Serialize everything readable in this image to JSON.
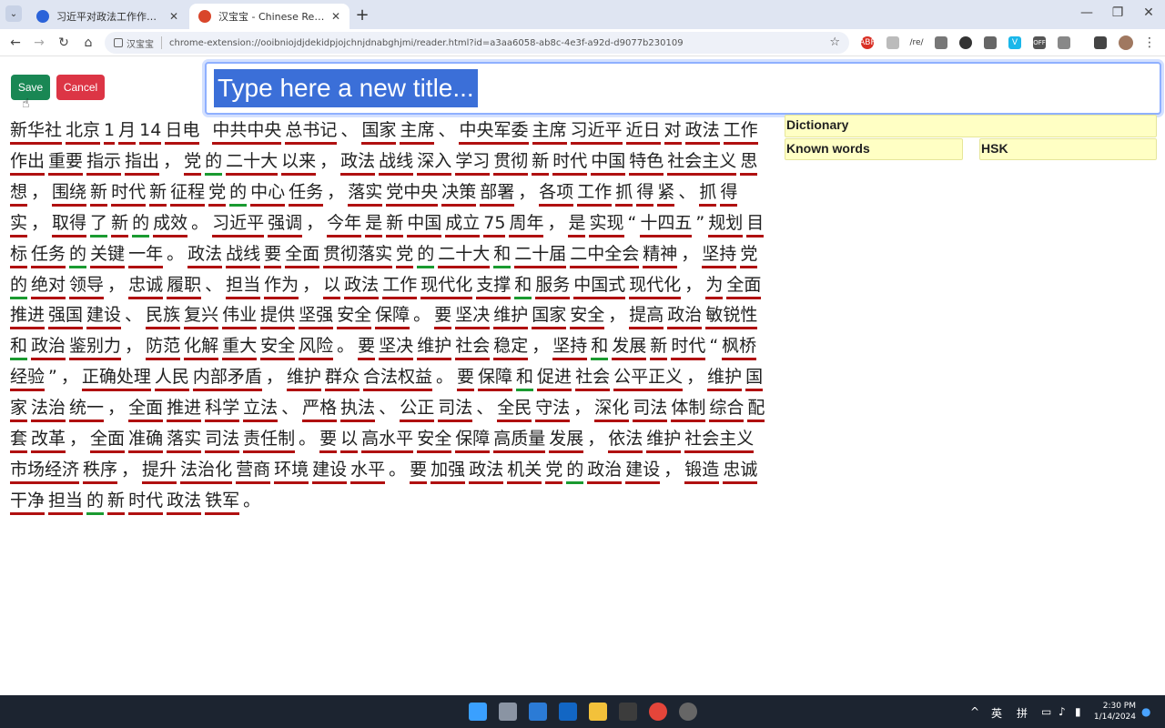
{
  "browser": {
    "tabs": [
      {
        "label": "习近平对政法工作作出重要指示",
        "favicon_color": "#2b63d9"
      },
      {
        "label": "汉宝宝 - Chinese Reader",
        "favicon_color": "#d9462b"
      }
    ],
    "new_tab": "+",
    "window_controls": {
      "minimize": "—",
      "restore": "❐",
      "close": "✕"
    },
    "nav": {
      "back": "←",
      "forward": "→",
      "reload": "↻",
      "home": "⌂"
    },
    "extension_chip": "汉宝宝",
    "url": "chrome-extension://ooibniojdjdekidpjojchnjdnabghjmi/reader.html?id=a3aa6058-ab8c-4e3f-a92d-d9077b230109",
    "star": "☆",
    "extensions": [
      "abp-icon",
      "layers-icon",
      "regex-icon",
      "camera-icon",
      "chat-icon",
      "copy-icon",
      "vimeo-icon",
      "off-icon",
      "puzzle-icon",
      "sidebar-icon"
    ]
  },
  "app": {
    "save_label": "Save",
    "cancel_label": "Cancel",
    "title_value": "Type here a new title...",
    "dictionary_label": "Dictionary",
    "known_words_label": "Known words",
    "hsk_label": "HSK",
    "words": [
      {
        "t": "新华社",
        "u": "r"
      },
      {
        "t": "北京",
        "u": "r"
      },
      {
        "t": "1",
        "u": "r"
      },
      {
        "t": "月",
        "u": "r"
      },
      {
        "t": "14",
        "u": "r"
      },
      {
        "t": "日电",
        "u": "r"
      },
      {
        "t": "  ",
        "u": "p"
      },
      {
        "t": "中共中央",
        "u": "r"
      },
      {
        "t": "总书记",
        "u": "r"
      },
      {
        "t": "、",
        "u": "p"
      },
      {
        "t": "国家",
        "u": "r"
      },
      {
        "t": "主席",
        "u": "r"
      },
      {
        "t": "、",
        "u": "p"
      },
      {
        "t": "中央军委",
        "u": "r"
      },
      {
        "t": "主席",
        "u": "r"
      },
      {
        "t": "习近平",
        "u": "r"
      },
      {
        "t": "近日",
        "u": "r"
      },
      {
        "t": "对",
        "u": "r"
      },
      {
        "t": "政法",
        "u": "r"
      },
      {
        "t": "工作",
        "u": "r"
      },
      {
        "t": "作出",
        "u": "r"
      },
      {
        "t": "重要",
        "u": "r"
      },
      {
        "t": "指示",
        "u": "r"
      },
      {
        "t": "指出",
        "u": "r"
      },
      {
        "t": "，",
        "u": "p"
      },
      {
        "t": "党",
        "u": "r"
      },
      {
        "t": "的",
        "u": "g"
      },
      {
        "t": "二十大",
        "u": "r"
      },
      {
        "t": "以来",
        "u": "r"
      },
      {
        "t": "，",
        "u": "p"
      },
      {
        "t": "政法",
        "u": "r"
      },
      {
        "t": "战线",
        "u": "r"
      },
      {
        "t": "深入",
        "u": "r"
      },
      {
        "t": "学习",
        "u": "r"
      },
      {
        "t": "贯彻",
        "u": "r"
      },
      {
        "t": "新",
        "u": "r"
      },
      {
        "t": "时代",
        "u": "r"
      },
      {
        "t": "中国",
        "u": "r"
      },
      {
        "t": "特色",
        "u": "r"
      },
      {
        "t": "社会主义",
        "u": "r"
      },
      {
        "t": "思想",
        "u": "r"
      },
      {
        "t": "，",
        "u": "p"
      },
      {
        "t": "围绕",
        "u": "r"
      },
      {
        "t": "新",
        "u": "r"
      },
      {
        "t": "时代",
        "u": "r"
      },
      {
        "t": "新",
        "u": "r"
      },
      {
        "t": "征程",
        "u": "r"
      },
      {
        "t": "党",
        "u": "r"
      },
      {
        "t": "的",
        "u": "g"
      },
      {
        "t": "中心",
        "u": "r"
      },
      {
        "t": "任务",
        "u": "r"
      },
      {
        "t": "，",
        "u": "p"
      },
      {
        "t": "落实",
        "u": "r"
      },
      {
        "t": "党中央",
        "u": "r"
      },
      {
        "t": "决策",
        "u": "r"
      },
      {
        "t": "部署",
        "u": "r"
      },
      {
        "t": "，",
        "u": "p"
      },
      {
        "t": "各项",
        "u": "r"
      },
      {
        "t": "工作",
        "u": "r"
      },
      {
        "t": "抓",
        "u": "r"
      },
      {
        "t": "得",
        "u": "r"
      },
      {
        "t": "紧",
        "u": "r"
      },
      {
        "t": "、",
        "u": "p"
      },
      {
        "t": "抓",
        "u": "r"
      },
      {
        "t": "得",
        "u": "r"
      },
      {
        "t": "实",
        "u": "r"
      },
      {
        "t": "，",
        "u": "p"
      },
      {
        "t": "取得",
        "u": "r"
      },
      {
        "t": "了",
        "u": "g"
      },
      {
        "t": "新",
        "u": "r"
      },
      {
        "t": "的",
        "u": "g"
      },
      {
        "t": "成效",
        "u": "r"
      },
      {
        "t": "。",
        "u": "p"
      },
      {
        "t": "习近平",
        "u": "r"
      },
      {
        "t": "强调",
        "u": "r"
      },
      {
        "t": "，",
        "u": "p"
      },
      {
        "t": "今年",
        "u": "r"
      },
      {
        "t": "是",
        "u": "r"
      },
      {
        "t": "新",
        "u": "r"
      },
      {
        "t": "中国",
        "u": "r"
      },
      {
        "t": "成立",
        "u": "r"
      },
      {
        "t": "75",
        "u": "r"
      },
      {
        "t": "周年",
        "u": "r"
      },
      {
        "t": "，",
        "u": "p"
      },
      {
        "t": "是",
        "u": "r"
      },
      {
        "t": "实现",
        "u": "r"
      },
      {
        "t": "“",
        "u": "p"
      },
      {
        "t": "十四五",
        "u": "r"
      },
      {
        "t": "”",
        "u": "p"
      },
      {
        "t": "规划",
        "u": "r"
      },
      {
        "t": "目标",
        "u": "r"
      },
      {
        "t": "任务",
        "u": "r"
      },
      {
        "t": "的",
        "u": "g"
      },
      {
        "t": "关键",
        "u": "r"
      },
      {
        "t": "一年",
        "u": "r"
      },
      {
        "t": "。",
        "u": "p"
      },
      {
        "t": "政法",
        "u": "r"
      },
      {
        "t": "战线",
        "u": "r"
      },
      {
        "t": "要",
        "u": "r"
      },
      {
        "t": "全面",
        "u": "r"
      },
      {
        "t": "贯彻落实",
        "u": "r"
      },
      {
        "t": "党",
        "u": "r"
      },
      {
        "t": "的",
        "u": "g"
      },
      {
        "t": "二十大",
        "u": "r"
      },
      {
        "t": "和",
        "u": "g"
      },
      {
        "t": "二十届",
        "u": "r"
      },
      {
        "t": "二中全会",
        "u": "r"
      },
      {
        "t": "精神",
        "u": "r"
      },
      {
        "t": "，",
        "u": "p"
      },
      {
        "t": "坚持",
        "u": "r"
      },
      {
        "t": "党",
        "u": "r"
      },
      {
        "t": "的",
        "u": "g"
      },
      {
        "t": "绝对",
        "u": "r"
      },
      {
        "t": "领导",
        "u": "r"
      },
      {
        "t": "，",
        "u": "p"
      },
      {
        "t": "忠诚",
        "u": "r"
      },
      {
        "t": "履职",
        "u": "r"
      },
      {
        "t": "、",
        "u": "p"
      },
      {
        "t": "担当",
        "u": "r"
      },
      {
        "t": "作为",
        "u": "r"
      },
      {
        "t": "，",
        "u": "p"
      },
      {
        "t": "以",
        "u": "r"
      },
      {
        "t": "政法",
        "u": "r"
      },
      {
        "t": "工作",
        "u": "r"
      },
      {
        "t": "现代化",
        "u": "r"
      },
      {
        "t": "支撑",
        "u": "r"
      },
      {
        "t": "和",
        "u": "g"
      },
      {
        "t": "服务",
        "u": "r"
      },
      {
        "t": "中国式",
        "u": "r"
      },
      {
        "t": "现代化",
        "u": "r"
      },
      {
        "t": "，",
        "u": "p"
      },
      {
        "t": "为",
        "u": "r"
      },
      {
        "t": "全面",
        "u": "r"
      },
      {
        "t": "推进",
        "u": "r"
      },
      {
        "t": "强国",
        "u": "r"
      },
      {
        "t": "建设",
        "u": "r"
      },
      {
        "t": "、",
        "u": "p"
      },
      {
        "t": "民族",
        "u": "r"
      },
      {
        "t": "复兴",
        "u": "r"
      },
      {
        "t": "伟业",
        "u": "r"
      },
      {
        "t": "提供",
        "u": "r"
      },
      {
        "t": "坚强",
        "u": "r"
      },
      {
        "t": "安全",
        "u": "r"
      },
      {
        "t": "保障",
        "u": "r"
      },
      {
        "t": "。",
        "u": "p"
      },
      {
        "t": "要",
        "u": "r"
      },
      {
        "t": "坚决",
        "u": "r"
      },
      {
        "t": "维护",
        "u": "r"
      },
      {
        "t": "国家",
        "u": "r"
      },
      {
        "t": "安全",
        "u": "r"
      },
      {
        "t": "，",
        "u": "p"
      },
      {
        "t": "提高",
        "u": "r"
      },
      {
        "t": "政治",
        "u": "r"
      },
      {
        "t": "敏锐性",
        "u": "r"
      },
      {
        "t": "和",
        "u": "g"
      },
      {
        "t": "政治",
        "u": "r"
      },
      {
        "t": "鉴别力",
        "u": "r"
      },
      {
        "t": "，",
        "u": "p"
      },
      {
        "t": "防范",
        "u": "r"
      },
      {
        "t": "化解",
        "u": "r"
      },
      {
        "t": "重大",
        "u": "r"
      },
      {
        "t": "安全",
        "u": "r"
      },
      {
        "t": "风险",
        "u": "r"
      },
      {
        "t": "。",
        "u": "p"
      },
      {
        "t": "要",
        "u": "r"
      },
      {
        "t": "坚决",
        "u": "r"
      },
      {
        "t": "维护",
        "u": "r"
      },
      {
        "t": "社会",
        "u": "r"
      },
      {
        "t": "稳定",
        "u": "r"
      },
      {
        "t": "，",
        "u": "p"
      },
      {
        "t": "坚持",
        "u": "r"
      },
      {
        "t": "和",
        "u": "g"
      },
      {
        "t": "发展",
        "u": "r"
      },
      {
        "t": "新",
        "u": "r"
      },
      {
        "t": "时代",
        "u": "r"
      },
      {
        "t": "“",
        "u": "p"
      },
      {
        "t": "枫桥",
        "u": "r"
      },
      {
        "t": "经验",
        "u": "r"
      },
      {
        "t": "”",
        "u": "p"
      },
      {
        "t": "，",
        "u": "p"
      },
      {
        "t": "正确处理",
        "u": "r"
      },
      {
        "t": "人民",
        "u": "r"
      },
      {
        "t": "内部矛盾",
        "u": "r"
      },
      {
        "t": "，",
        "u": "p"
      },
      {
        "t": "维护",
        "u": "r"
      },
      {
        "t": "群众",
        "u": "r"
      },
      {
        "t": "合法权益",
        "u": "r"
      },
      {
        "t": "。",
        "u": "p"
      },
      {
        "t": "要",
        "u": "r"
      },
      {
        "t": "保障",
        "u": "r"
      },
      {
        "t": "和",
        "u": "g"
      },
      {
        "t": "促进",
        "u": "r"
      },
      {
        "t": "社会",
        "u": "r"
      },
      {
        "t": "公平正义",
        "u": "r"
      },
      {
        "t": "，",
        "u": "p"
      },
      {
        "t": "维护",
        "u": "r"
      },
      {
        "t": "国家",
        "u": "r"
      },
      {
        "t": "法治",
        "u": "r"
      },
      {
        "t": "统一",
        "u": "r"
      },
      {
        "t": "，",
        "u": "p"
      },
      {
        "t": "全面",
        "u": "r"
      },
      {
        "t": "推进",
        "u": "r"
      },
      {
        "t": "科学",
        "u": "r"
      },
      {
        "t": "立法",
        "u": "r"
      },
      {
        "t": "、",
        "u": "p"
      },
      {
        "t": "严格",
        "u": "r"
      },
      {
        "t": "执法",
        "u": "r"
      },
      {
        "t": "、",
        "u": "p"
      },
      {
        "t": "公正",
        "u": "r"
      },
      {
        "t": "司法",
        "u": "r"
      },
      {
        "t": "、",
        "u": "p"
      },
      {
        "t": "全民",
        "u": "r"
      },
      {
        "t": "守法",
        "u": "r"
      },
      {
        "t": "，",
        "u": "p"
      },
      {
        "t": "深化",
        "u": "r"
      },
      {
        "t": "司法",
        "u": "r"
      },
      {
        "t": "体制",
        "u": "r"
      },
      {
        "t": "综合",
        "u": "r"
      },
      {
        "t": "配套",
        "u": "r"
      },
      {
        "t": "改革",
        "u": "r"
      },
      {
        "t": "，",
        "u": "p"
      },
      {
        "t": "全面",
        "u": "r"
      },
      {
        "t": "准确",
        "u": "r"
      },
      {
        "t": "落实",
        "u": "r"
      },
      {
        "t": "司法",
        "u": "r"
      },
      {
        "t": "责任制",
        "u": "r"
      },
      {
        "t": "。",
        "u": "p"
      },
      {
        "t": "要",
        "u": "r"
      },
      {
        "t": "以",
        "u": "r"
      },
      {
        "t": "高水平",
        "u": "r"
      },
      {
        "t": "安全",
        "u": "r"
      },
      {
        "t": "保障",
        "u": "r"
      },
      {
        "t": "高质量",
        "u": "r"
      },
      {
        "t": "发展",
        "u": "r"
      },
      {
        "t": "，",
        "u": "p"
      },
      {
        "t": "依法",
        "u": "r"
      },
      {
        "t": "维护",
        "u": "r"
      },
      {
        "t": "社会主义",
        "u": "r"
      },
      {
        "t": "市场经济",
        "u": "r"
      },
      {
        "t": "秩序",
        "u": "r"
      },
      {
        "t": "，",
        "u": "p"
      },
      {
        "t": "提升",
        "u": "r"
      },
      {
        "t": "法治化",
        "u": "r"
      },
      {
        "t": "营商",
        "u": "r"
      },
      {
        "t": "环境",
        "u": "r"
      },
      {
        "t": "建设",
        "u": "r"
      },
      {
        "t": "水平",
        "u": "r"
      },
      {
        "t": "。",
        "u": "p"
      },
      {
        "t": "要",
        "u": "r"
      },
      {
        "t": "加强",
        "u": "r"
      },
      {
        "t": "政法",
        "u": "r"
      },
      {
        "t": "机关",
        "u": "r"
      },
      {
        "t": "党",
        "u": "r"
      },
      {
        "t": "的",
        "u": "g"
      },
      {
        "t": "政治",
        "u": "r"
      },
      {
        "t": "建设",
        "u": "r"
      },
      {
        "t": "，",
        "u": "p"
      },
      {
        "t": "锻造",
        "u": "r"
      },
      {
        "t": "忠诚",
        "u": "r"
      },
      {
        "t": "干净",
        "u": "r"
      },
      {
        "t": "担当",
        "u": "r"
      },
      {
        "t": "的",
        "u": "g"
      },
      {
        "t": "新",
        "u": "r"
      },
      {
        "t": "时代",
        "u": "r"
      },
      {
        "t": "政法",
        "u": "r"
      },
      {
        "t": "铁军",
        "u": "r"
      },
      {
        "t": "。",
        "u": "p"
      }
    ]
  },
  "taskbar": {
    "tray": {
      "chevron": "^",
      "lang": "英",
      "ime": "拼"
    },
    "time": "2:30 PM",
    "date": "1/14/2024"
  }
}
